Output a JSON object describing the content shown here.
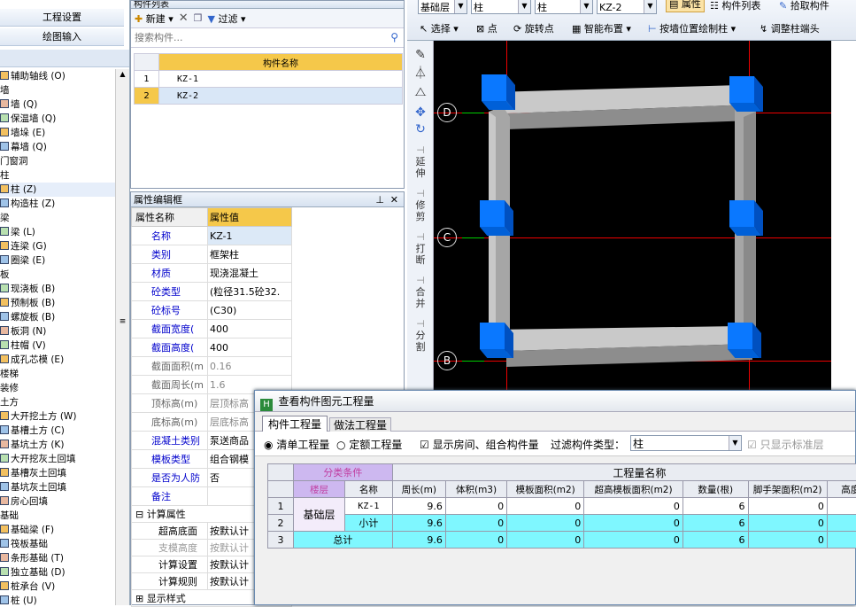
{
  "left_panel": {
    "nav_buttons": [
      "工程设置",
      "绘图输入"
    ],
    "tree": [
      {
        "label": "辅助轴线 (O)",
        "indent": 1
      },
      {
        "label": "墙",
        "indent": 0
      },
      {
        "label": "墙 (Q)",
        "indent": 1
      },
      {
        "label": "保温墙 (Q)",
        "indent": 1
      },
      {
        "label": "墙垛 (E)",
        "indent": 1
      },
      {
        "label": "幕墙 (Q)",
        "indent": 1
      },
      {
        "label": "门窗洞",
        "indent": 0
      },
      {
        "label": "柱",
        "indent": 0
      },
      {
        "label": "柱 (Z)",
        "indent": 1
      },
      {
        "label": "构造柱 (Z)",
        "indent": 1
      },
      {
        "label": "梁",
        "indent": 0
      },
      {
        "label": "梁 (L)",
        "indent": 1
      },
      {
        "label": "连梁 (G)",
        "indent": 1
      },
      {
        "label": "圈梁 (E)",
        "indent": 1
      },
      {
        "label": "板",
        "indent": 0
      },
      {
        "label": "现浇板 (B)",
        "indent": 1
      },
      {
        "label": "预制板 (B)",
        "indent": 1
      },
      {
        "label": "螺旋板 (B)",
        "indent": 1
      },
      {
        "label": "板洞 (N)",
        "indent": 1
      },
      {
        "label": "柱帽 (V)",
        "indent": 1
      },
      {
        "label": "成孔芯模 (E)",
        "indent": 1
      },
      {
        "label": "楼梯",
        "indent": 0
      },
      {
        "label": "装修",
        "indent": 0
      },
      {
        "label": "土方",
        "indent": 0
      },
      {
        "label": "大开挖土方 (W)",
        "indent": 1
      },
      {
        "label": "基槽土方 (C)",
        "indent": 1
      },
      {
        "label": "基坑土方 (K)",
        "indent": 1
      },
      {
        "label": "大开挖灰土回填",
        "indent": 1
      },
      {
        "label": "基槽灰土回填",
        "indent": 1
      },
      {
        "label": "基坑灰土回填",
        "indent": 1
      },
      {
        "label": "房心回填",
        "indent": 1
      },
      {
        "label": "基础",
        "indent": 0
      },
      {
        "label": "基础梁 (F)",
        "indent": 1
      },
      {
        "label": "筏板基础",
        "indent": 1
      },
      {
        "label": "条形基础 (T)",
        "indent": 1
      },
      {
        "label": "独立基础 (D)",
        "indent": 1
      },
      {
        "label": "桩承台 (V)",
        "indent": 1
      },
      {
        "label": "桩 (U)",
        "indent": 1
      }
    ]
  },
  "component_list": {
    "title": "构件列表",
    "new_label": "新建",
    "filter_label": "过滤",
    "search_placeholder": "搜索构件...",
    "column_header": "构件名称",
    "rows": [
      {
        "num": "1",
        "name": "KZ-1"
      },
      {
        "num": "2",
        "name": "KZ-2"
      }
    ]
  },
  "property_editor": {
    "title": "属性编辑框",
    "col_name": "属性名称",
    "col_value": "属性值",
    "rows": [
      {
        "name": "名称",
        "value": "KZ-1",
        "link": true
      },
      {
        "name": "类别",
        "value": "框架柱",
        "link": true
      },
      {
        "name": "材质",
        "value": "现浇混凝土",
        "link": true
      },
      {
        "name": "砼类型",
        "value": "(粒径31.5砼32.",
        "link": true
      },
      {
        "name": "砼标号",
        "value": "(C30)",
        "link": true
      },
      {
        "name": "截面宽度(",
        "value": "400",
        "link": true
      },
      {
        "name": "截面高度(",
        "value": "400",
        "link": true
      },
      {
        "name": "截面面积(m",
        "value": "0.16",
        "link": false
      },
      {
        "name": "截面周长(m",
        "value": "1.6",
        "link": false
      },
      {
        "name": "顶标高(m)",
        "value": "层顶标高",
        "link": false
      },
      {
        "name": "底标高(m)",
        "value": "层底标高",
        "link": false
      },
      {
        "name": "混凝土类别",
        "value": "泵送商品",
        "link": true
      },
      {
        "name": "模板类型",
        "value": "组合钢模",
        "link": true
      },
      {
        "name": "是否为人防",
        "value": "否",
        "link": true
      },
      {
        "name": "备注",
        "value": "",
        "link": true
      }
    ],
    "calc_group": "计算属性",
    "calc_rows": [
      {
        "name": "超高底面",
        "value": "按默认计"
      },
      {
        "name": "支模高度",
        "value": "按默认计"
      },
      {
        "name": "计算设置",
        "value": "按默认计"
      },
      {
        "name": "计算规则",
        "value": "按默认计"
      }
    ],
    "display_group": "显示样式"
  },
  "toolbar": {
    "floor_select": "基础层",
    "type_select": "柱",
    "subtype_select": "柱",
    "component_select": "KZ-2",
    "property_btn": "属性",
    "component_list_btn": "构件列表",
    "pick_btn": "拾取构件",
    "select_btn": "选择",
    "point_btn": "点",
    "rotate_point_btn": "旋转点",
    "smart_layout_btn": "智能布置",
    "wall_draw_btn": "按墙位置绘制柱",
    "adjust_btn": "调整柱端头"
  },
  "side_tools": [
    "延伸",
    "修剪",
    "打断",
    "合并",
    "分割"
  ],
  "axis_labels": [
    "D",
    "C",
    "B"
  ],
  "dialog": {
    "title": "查看构件图元工程量",
    "tabs": [
      "构件工程量",
      "做法工程量"
    ],
    "radio_list": "清单工程量",
    "radio_quota": "定额工程量",
    "checkbox_rooms": "显示房间、组合构件量",
    "filter_label": "过滤构件类型：",
    "filter_value": "柱",
    "checkbox_std": "只显示标准层",
    "group_header": "分类条件",
    "qty_header": "工程量名称",
    "columns": [
      "楼层",
      "名称",
      "周长(m)",
      "体积(m3)",
      "模板面积(m2)",
      "超高模板面积(m2)",
      "数量(根)",
      "脚手架面积(m2)",
      "高度(m"
    ],
    "rows": [
      {
        "num": "1",
        "floor": "基础层",
        "name": "KZ-1",
        "perimeter": "9.6",
        "volume": "0",
        "formwork": "0",
        "over_formwork": "0",
        "count": "6",
        "scaffold": "0",
        "height": "0"
      },
      {
        "num": "2",
        "floor": "",
        "name": "小计",
        "perimeter": "9.6",
        "volume": "0",
        "formwork": "0",
        "over_formwork": "0",
        "count": "6",
        "scaffold": "0",
        "height": "0"
      },
      {
        "num": "3",
        "floor": "总计",
        "name": "",
        "perimeter": "9.6",
        "volume": "0",
        "formwork": "0",
        "over_formwork": "0",
        "count": "6",
        "scaffold": "0",
        "height": "0"
      }
    ]
  },
  "colors": {
    "column_blue": "#0a78ff",
    "beam_gray": "#a6a6a6",
    "grid_red": "#e00000",
    "link_blue": "#0000cc",
    "total_cyan": "#7ff7ff",
    "header_violet": "#cdb8f0"
  }
}
